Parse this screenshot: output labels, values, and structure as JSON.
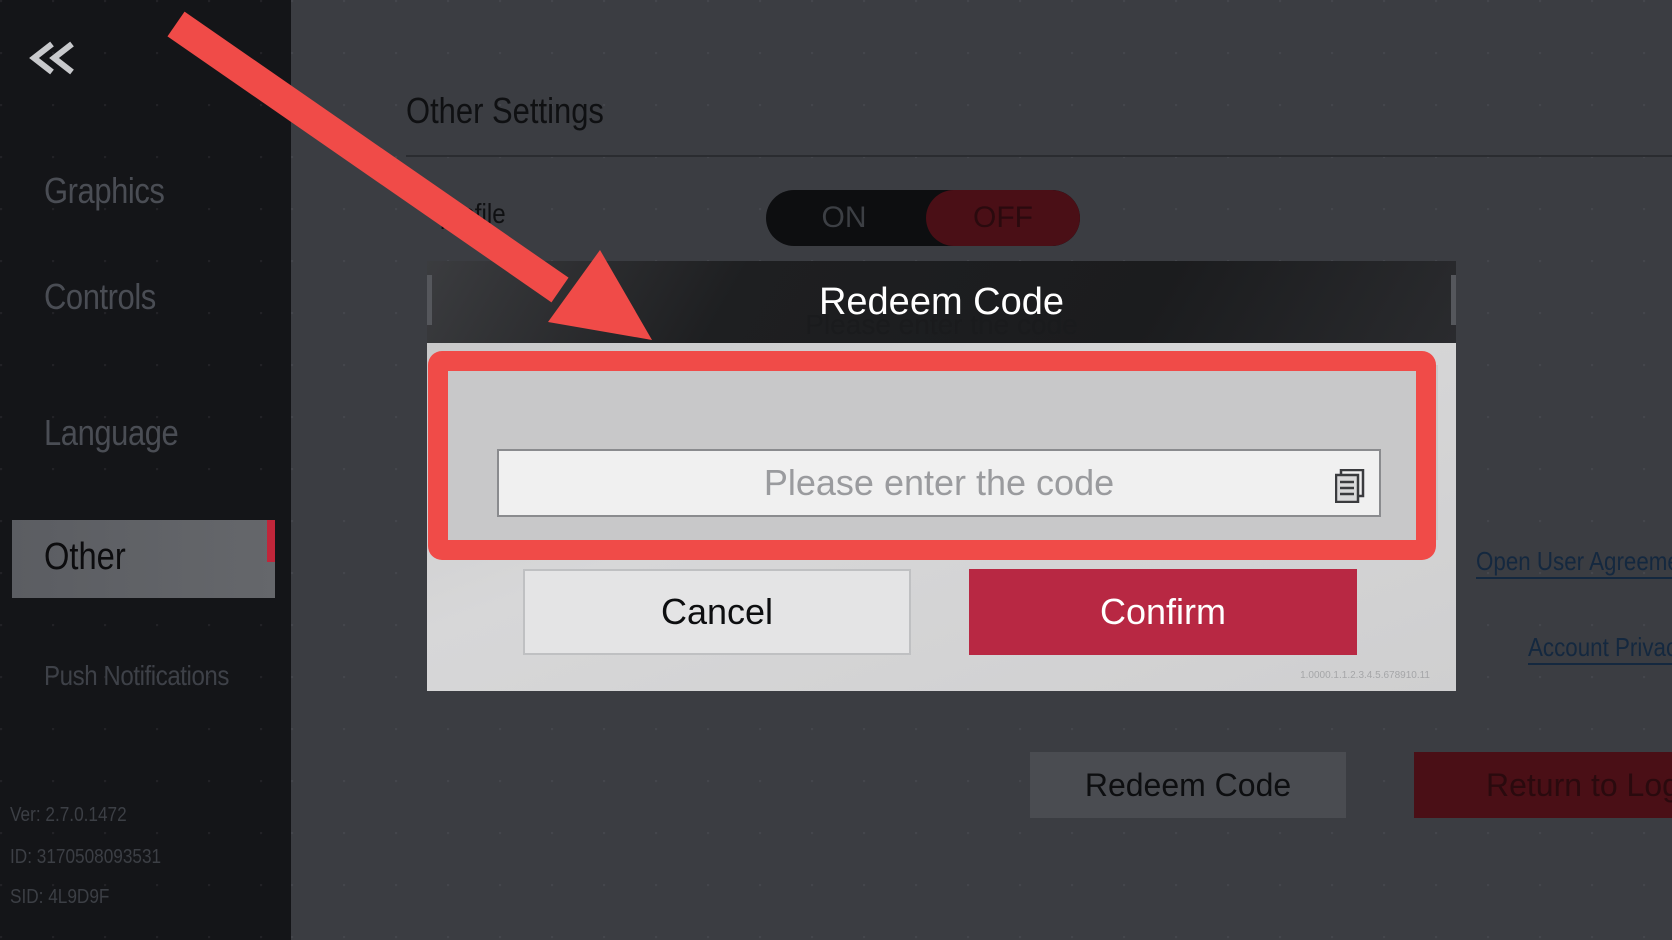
{
  "sidebar": {
    "items": [
      {
        "label": "Graphics"
      },
      {
        "label": "Controls"
      },
      {
        "label": "Language"
      },
      {
        "label": "Other"
      },
      {
        "label": "Push Notifications"
      }
    ],
    "version": "Ver: 2.7.0.1472",
    "id": "ID: 3170508093531",
    "sid": "SID: 4L9D9F"
  },
  "main": {
    "section_title": "Other Settings",
    "profile_label": "profile",
    "toggle": {
      "on_label": "ON",
      "off_label": "OFF",
      "selected": "OFF"
    },
    "links": {
      "agreement": "Open User Agreement",
      "privacy": "Account Privacy"
    },
    "buttons": {
      "redeem": "Redeem Code",
      "return_login": "Return to Login"
    }
  },
  "dialog": {
    "title": "Redeem Code",
    "prompt": "Please enter the code",
    "input": {
      "value": "",
      "placeholder": "Please enter the code"
    },
    "cancel_label": "Cancel",
    "confirm_label": "Confirm",
    "build": "1.0000.1.1.2.3.4.5.678910.11"
  },
  "colors": {
    "accent_red": "#b82843",
    "annotation_red": "#f04b48",
    "sidebar_bg": "#141518"
  },
  "icons": {
    "back": "double-chevron-left-icon",
    "paste": "clipboard-icon"
  }
}
